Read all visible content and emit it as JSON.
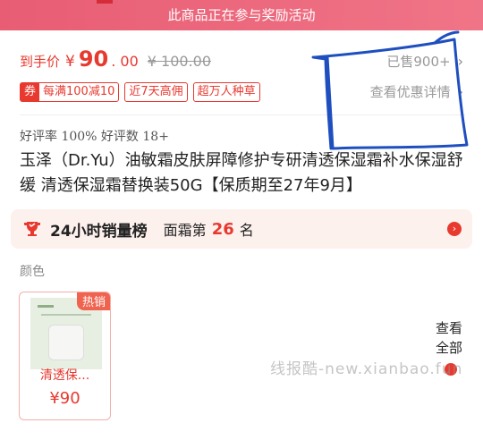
{
  "banner": {
    "text": "此商品正在参与奖励活动"
  },
  "price": {
    "label": "到手价",
    "currency": "¥",
    "integer": "90",
    "decimal": ". 00",
    "original": "¥ 100.00"
  },
  "sales": {
    "sold_text": "已售900+",
    "details_text": "查看优惠详情"
  },
  "tags": {
    "coupon_mark": "券",
    "coupon_text": "每满100减10",
    "return_text": "近7天高佣",
    "recommend_text": "超万人种草"
  },
  "rating": {
    "text": "好评率 100%  好评数 18+"
  },
  "product": {
    "title": "玉泽（Dr.Yu）油敏霜皮肤屏障修护专研清透保湿霜补水保湿舒缓 清透保湿霜替换装50G【保质期至27年9月】"
  },
  "ranking": {
    "title": "24小时销量榜",
    "category": "面霜第",
    "number": "26",
    "unit": "名"
  },
  "options": {
    "color_label": "颜色",
    "sku": {
      "badge": "热销",
      "name": "清透保...",
      "price": "¥90"
    },
    "view_all": "查看全部"
  },
  "watermark": {
    "text": "线报酷-new.xianbao.fun"
  },
  "colors": {
    "accent": "#e8392f",
    "banner": "#e85d74",
    "annotation": "#1f4fbf"
  }
}
